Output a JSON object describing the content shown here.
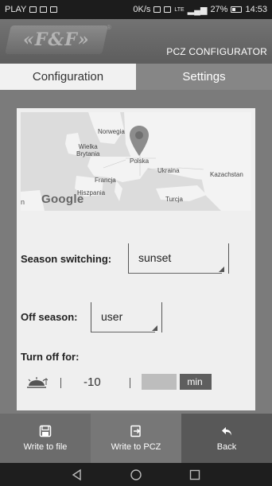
{
  "status_bar": {
    "carrier": "PLAY",
    "network_speed": "0K/s",
    "signal_type": "LTE",
    "battery": "27%",
    "time": "14:53"
  },
  "header": {
    "logo_text": "«F&F»",
    "logo_mark": "®",
    "title": "PCZ CONFIGURATOR"
  },
  "tabs": [
    {
      "label": "Configuration",
      "active": true
    },
    {
      "label": "Settings",
      "active": false
    }
  ],
  "map": {
    "provider": "Google",
    "labels": {
      "norway": "Norwegia",
      "uk": "Wielka\nBrytania",
      "poland": "Polska",
      "ukraine": "Ukraina",
      "kazakhstan": "Kazachstan",
      "france": "Francja",
      "spain": "Hiszpania",
      "turkey": "Turcja",
      "edge": "n"
    },
    "marker_icon": "map-pin-icon"
  },
  "config": {
    "season_switching_label": "Season switching:",
    "season_switching_value": "sunset",
    "off_season_label": "Off season:",
    "off_season_value": "user",
    "turn_off_label": "Turn off for:",
    "offset_value": "-10",
    "offset_unit": "min",
    "sunset_icon": "sunset-icon",
    "slider_level": 0.46
  },
  "bottom_bar": {
    "write_file": {
      "label": "Write to file",
      "icon": "floppy-disk-icon"
    },
    "write_pcz": {
      "label": "Write to PCZ",
      "icon": "export-icon"
    },
    "back": {
      "label": "Back",
      "icon": "reply-arrow-icon"
    }
  },
  "colors": {
    "active_tab": "#f1f1f1",
    "inactive_tab": "#868686",
    "content_bg": "#7b7b7b",
    "panel_bg": "#efefef",
    "slider_fill": "#5e5e5e"
  }
}
